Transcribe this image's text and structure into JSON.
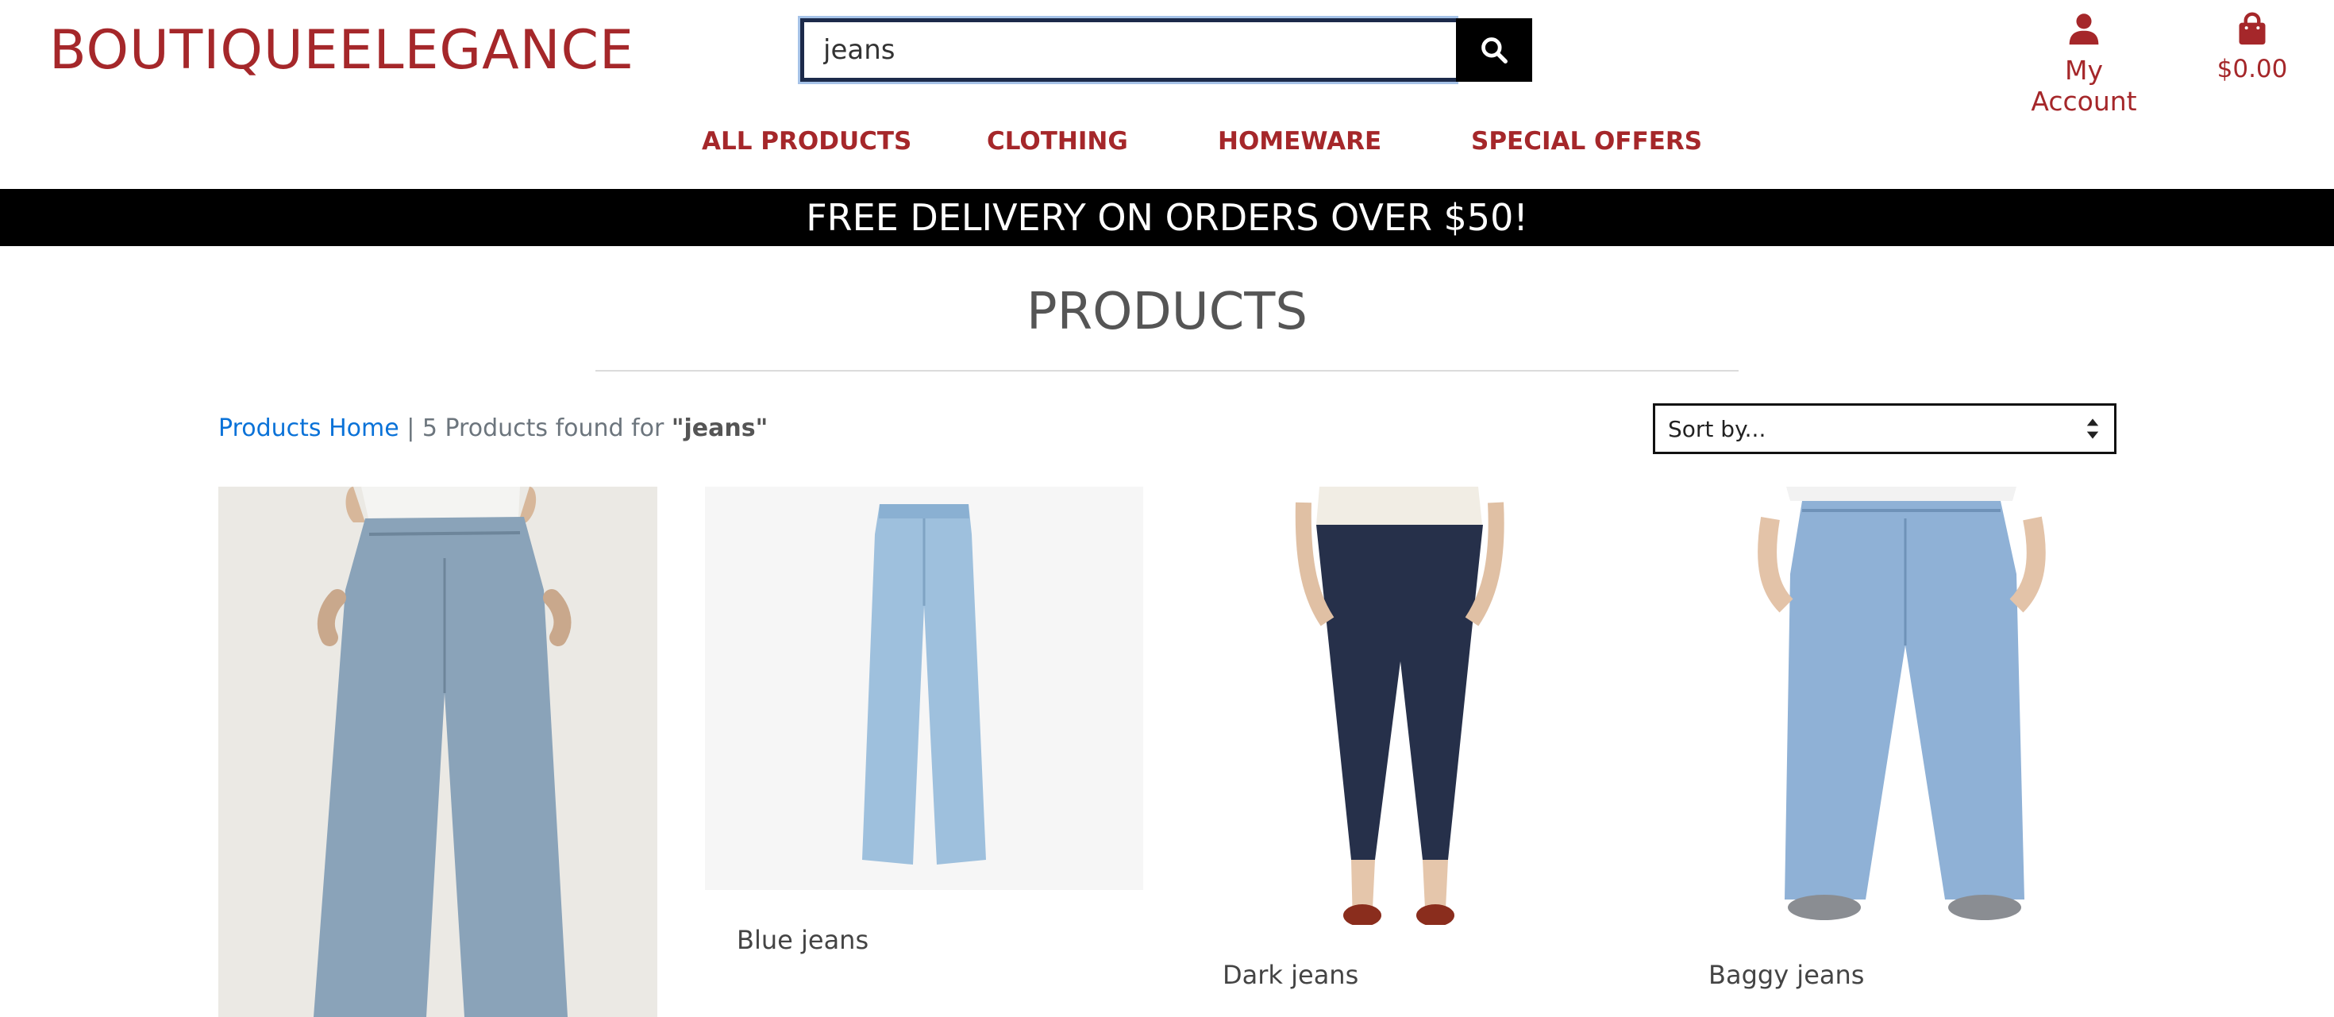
{
  "header": {
    "brand": "BOUTIQUEELEGANCE",
    "search": {
      "value": "jeans",
      "placeholder": ""
    },
    "account_label": "My Account",
    "cart_total": "$0.00"
  },
  "nav": {
    "items": [
      "ALL PRODUCTS",
      "CLOTHING",
      "HOMEWARE",
      "SPECIAL OFFERS"
    ]
  },
  "banner": "FREE DELIVERY ON ORDERS OVER $50!",
  "main": {
    "title": "PRODUCTS",
    "breadcrumb": {
      "home_link": "Products Home",
      "separator": "|",
      "count_text": "5 Products found for",
      "query": "\"jeans\""
    },
    "sort_label": "Sort by...",
    "products": [
      {
        "name": "",
        "icon": "wide-leg-jeans-photo"
      },
      {
        "name": "Blue jeans",
        "icon": "blue-jeans-photo"
      },
      {
        "name": "Dark jeans",
        "icon": "dark-jeans-photo"
      },
      {
        "name": "Baggy jeans",
        "icon": "baggy-jeans-photo"
      }
    ]
  },
  "colors": {
    "brand": "#a5272a",
    "banner_bg": "#000000",
    "link": "#0a72d8"
  }
}
